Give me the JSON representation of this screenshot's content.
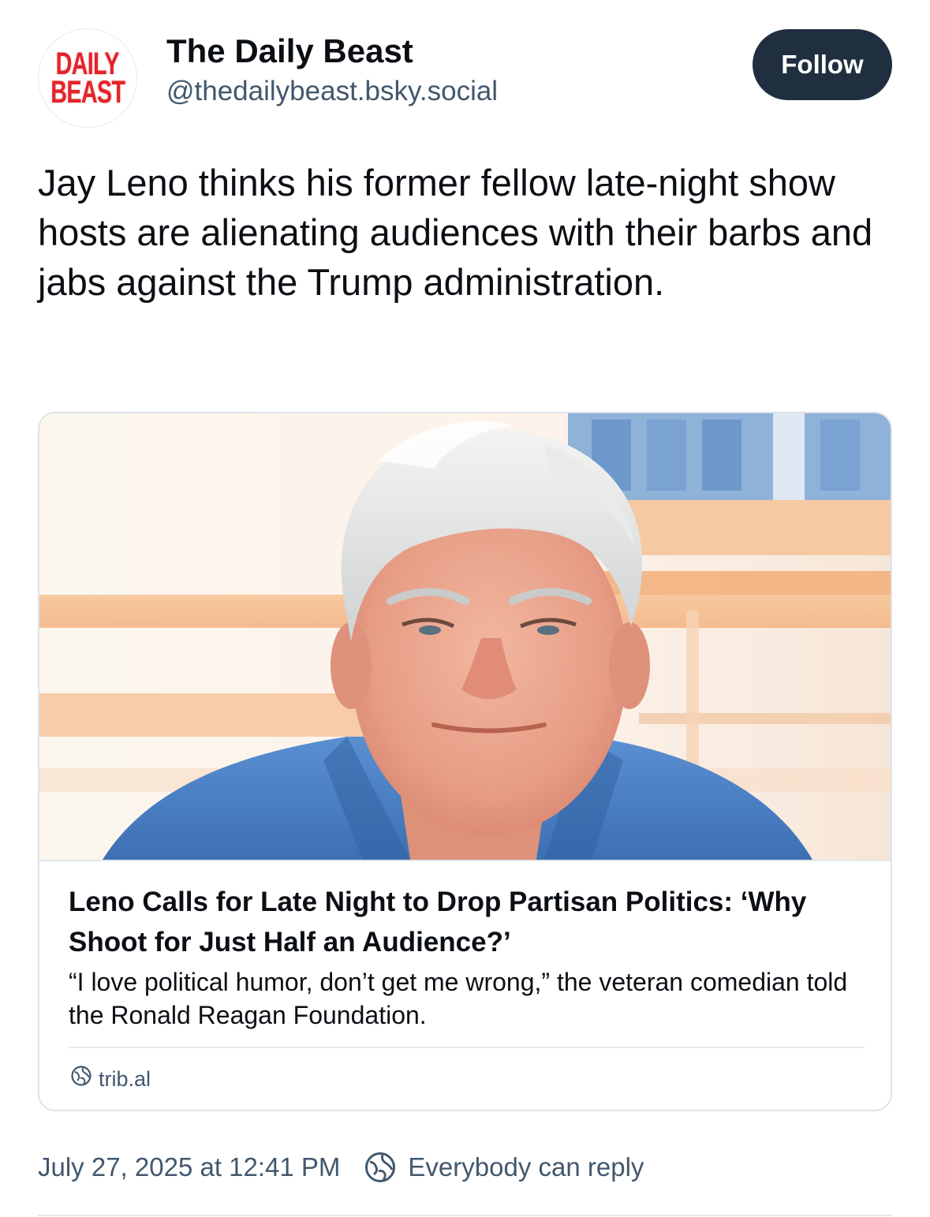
{
  "author": {
    "avatar_logo_text": [
      "DAILY",
      "BEAST"
    ],
    "display_name": "The Daily Beast",
    "handle": "@thedailybeast.bsky.social",
    "follow_label": "Follow"
  },
  "post": {
    "text": "Jay Leno thinks his former fellow late-night show hosts are alienating audiences with their barbs and jabs against the Trump administration."
  },
  "link_card": {
    "image_subject": "portrait-photo",
    "title": "Leno Calls for Late Night to Drop Partisan Politics: ‘Why Shoot for Just Half an Audience?’",
    "description": "“I love political humor, don’t get me wrong,” the veteran comedian told the Ronald Reagan Foundation.",
    "domain": "trib.al",
    "domain_icon": "globe-icon"
  },
  "meta": {
    "timestamp": "July 27, 2025 at 12:41 PM",
    "reply_setting": "Everybody can reply",
    "reply_icon": "globe-icon"
  },
  "colors": {
    "follow_button_bg": "#202f3f",
    "muted_text": "#42576c",
    "logo_red": "#e3242b"
  }
}
